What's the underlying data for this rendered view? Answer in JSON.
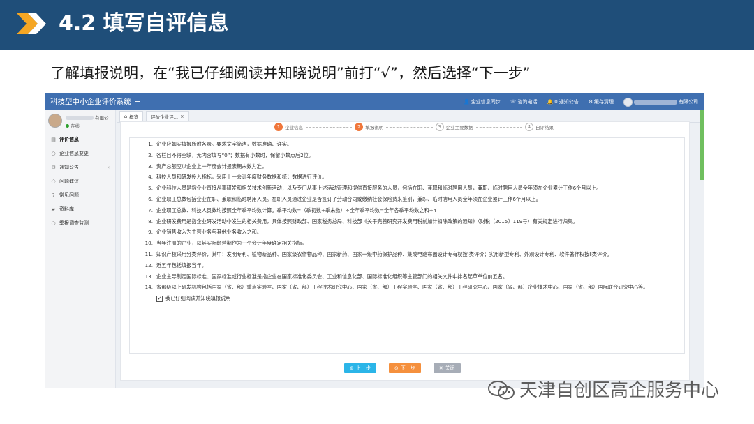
{
  "slide": {
    "title": "4.2 填写自评信息",
    "subtitle": "了解填报说明，在“我已仔细阅读并知晓说明”前打“√”，然后选择“下一步”",
    "header_color": "#1f4e79",
    "accent_color": "#f5a623"
  },
  "app": {
    "title": "科技型中小企业评价系统",
    "menu_icon": "hamburger-icon",
    "top_links": [
      {
        "icon": "user-icon",
        "label": "企业信息同步"
      },
      {
        "icon": "phone-icon",
        "label": "咨询电话"
      },
      {
        "icon": "bell-icon",
        "label": "通知公告",
        "badge": "0"
      },
      {
        "icon": "gear-icon",
        "label": "缓存清理"
      }
    ],
    "company_suffix": "有限公司",
    "user": {
      "name_suffix": "有限公",
      "status": "在线"
    },
    "sidebar": [
      {
        "label": "评价信息",
        "icon": "doc-icon",
        "active": true
      },
      {
        "label": "企业信息变更",
        "icon": "circle-icon"
      },
      {
        "label": "通知公告",
        "icon": "mail-icon",
        "arrow": "‹"
      },
      {
        "label": "问题建议",
        "icon": "chat-icon"
      },
      {
        "label": "常见问题",
        "icon": "question-icon"
      },
      {
        "label": "资料库",
        "icon": "folder-icon"
      },
      {
        "label": "季报调查监测",
        "icon": "circle-icon"
      }
    ],
    "tabs": [
      {
        "label": "概览",
        "icon": "home-icon"
      },
      {
        "label": "评价企业评…",
        "close": "×"
      }
    ],
    "steps": [
      {
        "num": "1",
        "label": "企业信息",
        "state": "done"
      },
      {
        "num": "2",
        "label": "填报说明",
        "state": "current"
      },
      {
        "num": "3",
        "label": "企业主要数据",
        "state": "todo"
      },
      {
        "num": "4",
        "label": "自评结果",
        "state": "todo"
      }
    ],
    "notes": [
      "企业应如实填报所附各表。要求文字简洁，数据准确、详实。",
      "各栏目不得空缺，无内容填写“0”；数据有小数时，保留小数点后2位。",
      "资产总额应以企业上一年度会计报表期末数为准。",
      "科技人员和研发投入指标，采用上一会计年度财务数据和统计数据进行评价。",
      "企业科技人员是指企业直接从事研发和相关技术创新活动，以及专门从事上述活动管理和提供直接服务的人员，包括在职、兼职和临时聘用人员，兼职、临时聘用人员全年须在企业累计工作6个月以上。",
      "企业职工总数包括企业在职、兼职和临时聘用人员。在职人员通过企业是否签订了劳动合同或缴纳社会保险费来鉴别，兼职、临时聘用人员全年须在企业累计工作6个月以上。",
      "企业职工总数、科技人员数均按照全年季平均数计算。季平均数=（季初数+季末数）÷全年季平均数=全年各季平均数之和÷4",
      "企业研发费用是指企业研发活动中发生的相关费用，具体按照财政部、国家税务总局、科技部《关于完善研究开发费用税前加计扣除政策的通知》（财税〔2015〕119号）有关规定进行归集。",
      "企业销售收入为主营业务与其他业务收入之和。",
      "当年注册的企业，以其实际经营期作为一个会计年度确定相关指标。",
      "知识产权采用分类评价，其中：发明专利、植物新品种、国家级农作物品种、国家新药、国家一级中药保护品种、集成电路布图设计专有权按Ⅰ类评价；实用新型专利、外观设计专利、软件著作权按Ⅱ类评价。",
      "近五年包括填报当年。",
      "企业主导制定国际标准、国家标准或行业标准是指企业在国家标准化委员会、工业和信息化部、国际标准化组织等主管部门的相关文件中排名起草单位前五名。",
      "省部级以上研发机构包括国家（省、部）重点实验室、国家（省、部）工程技术研究中心、国家（省、部）工程实验室、国家（省、部）工程研究中心、国家（省、部）企业技术中心、国家（省、部）国际联合研究中心等。"
    ],
    "agree_label": "我已仔细阅读并知晓填报说明",
    "agree_checked": true,
    "buttons": {
      "prev": "上一步",
      "next": "下一步",
      "close": "关闭"
    }
  },
  "watermark": "天津自创区高企服务中心"
}
